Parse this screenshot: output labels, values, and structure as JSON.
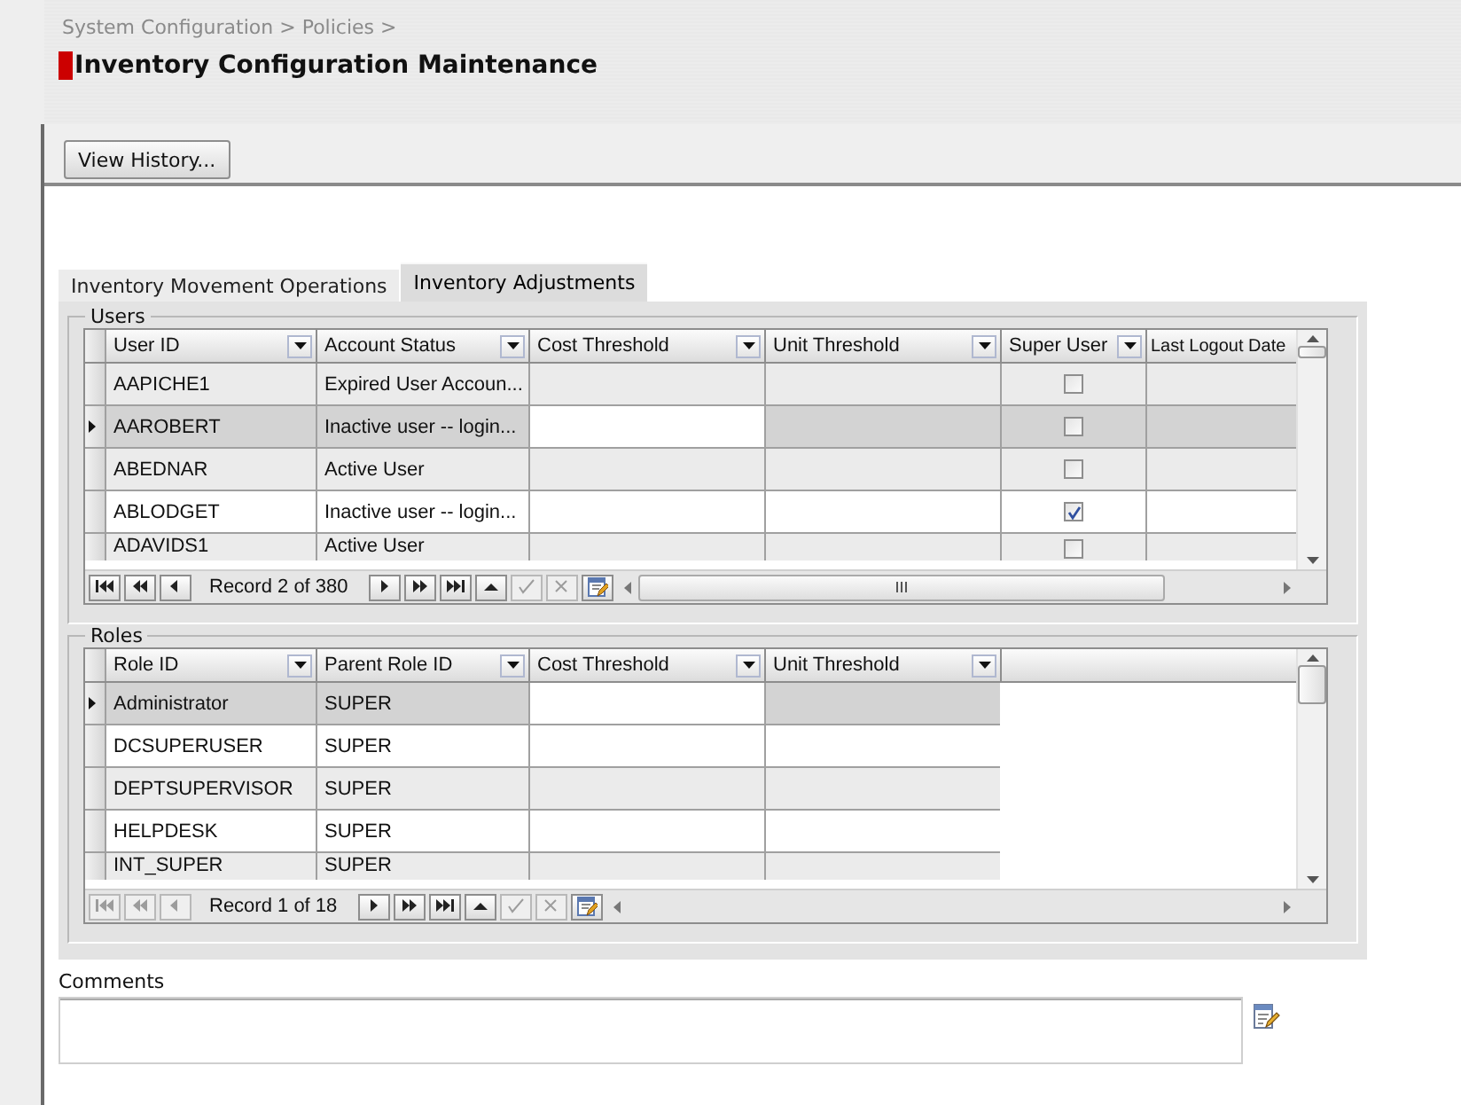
{
  "breadcrumb": "System Configuration > Policies >",
  "title": "Inventory Configuration Maintenance",
  "toolbar": {
    "buttons": [
      "View History..."
    ]
  },
  "tabs": [
    {
      "label": "Inventory Movement Operations",
      "selected": false
    },
    {
      "label": "Inventory Adjustments",
      "selected": true
    }
  ],
  "users": {
    "title": "Users",
    "columns": [
      "User ID",
      "Account Status",
      "Cost Threshold",
      "Unit Threshold",
      "Super User",
      "Last Logout Date"
    ],
    "rows": [
      {
        "user_id": "AAPICHE1",
        "account_status": "Expired User Accoun...",
        "super_user": false,
        "selected": false
      },
      {
        "user_id": "AAROBERT",
        "account_status": "Inactive user -- login...",
        "super_user": false,
        "selected": true
      },
      {
        "user_id": "ABEDNAR",
        "account_status": "Active User",
        "super_user": false,
        "selected": false
      },
      {
        "user_id": "ABLODGET",
        "account_status": "Inactive user -- login...",
        "super_user": true,
        "selected": false
      },
      {
        "user_id": "ADAVIDS1",
        "account_status": "Active User",
        "super_user": false,
        "selected": false
      }
    ],
    "record": "Record 2 of 380",
    "nav": [
      {
        "kind": "first",
        "disabled": false
      },
      {
        "kind": "prev-page",
        "disabled": false
      },
      {
        "kind": "prev",
        "disabled": false
      },
      {
        "kind": "next",
        "disabled": false
      },
      {
        "kind": "next-page",
        "disabled": false
      },
      {
        "kind": "last",
        "disabled": false
      },
      {
        "kind": "insert",
        "disabled": false
      },
      {
        "kind": "apply",
        "disabled": true
      },
      {
        "kind": "cancel",
        "disabled": true
      },
      {
        "kind": "edit",
        "disabled": false
      }
    ]
  },
  "roles": {
    "title": "Roles",
    "columns": [
      "Role ID",
      "Parent Role ID",
      "Cost Threshold",
      "Unit Threshold"
    ],
    "rows": [
      {
        "role_id": "Administrator",
        "parent_role_id": "SUPER",
        "selected": true
      },
      {
        "role_id": "DCSUPERUSER",
        "parent_role_id": "SUPER",
        "selected": false
      },
      {
        "role_id": "DEPTSUPERVISOR",
        "parent_role_id": "SUPER",
        "selected": false
      },
      {
        "role_id": "HELPDESK",
        "parent_role_id": "SUPER",
        "selected": false
      },
      {
        "role_id": "INT_SUPER",
        "parent_role_id": "SUPER",
        "selected": false
      }
    ],
    "record": "Record 1 of 18",
    "nav": [
      {
        "kind": "first",
        "disabled": true
      },
      {
        "kind": "prev-page",
        "disabled": true
      },
      {
        "kind": "prev",
        "disabled": true
      },
      {
        "kind": "next",
        "disabled": false
      },
      {
        "kind": "next-page",
        "disabled": false
      },
      {
        "kind": "last",
        "disabled": false
      },
      {
        "kind": "insert",
        "disabled": false
      },
      {
        "kind": "apply",
        "disabled": true
      },
      {
        "kind": "cancel",
        "disabled": true
      },
      {
        "kind": "edit",
        "disabled": false
      }
    ]
  },
  "comments": {
    "label": "Comments"
  }
}
